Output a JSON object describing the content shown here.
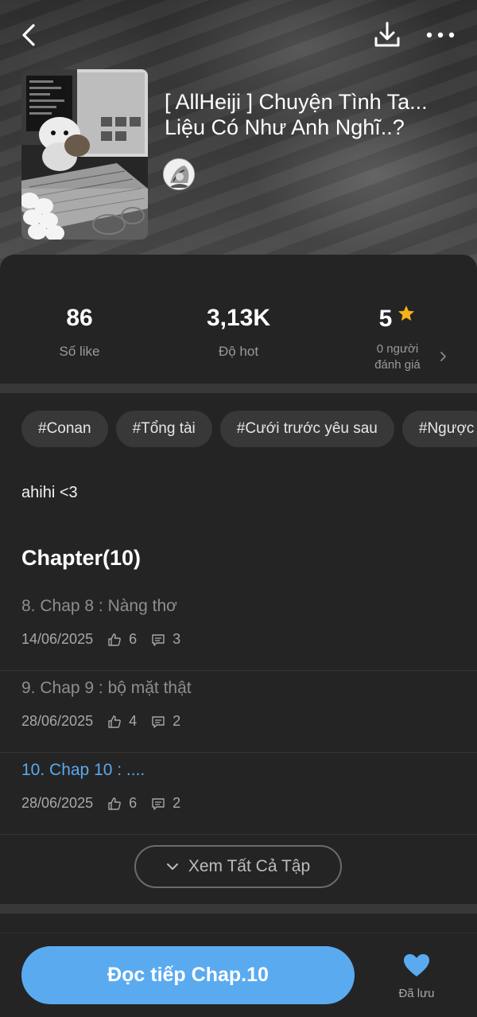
{
  "header": {
    "title": "[ AllHeiji ] Chuyện Tình Ta...\nLiệu Có Như Anh Nghĩ..?",
    "icons": {
      "back": "chevron-left-icon",
      "download": "download-icon",
      "more": "more-horizontal-icon"
    }
  },
  "stats": {
    "likes": {
      "value": "86",
      "label": "Số like"
    },
    "hot": {
      "value": "3,13K",
      "label": "Độ hot"
    },
    "rating": {
      "value": "5",
      "label_line1": "0 người",
      "label_line2": "đánh giá",
      "star_color": "#f5b21b"
    }
  },
  "tags": [
    "#Conan",
    "#Tổng tài",
    "#Cưới trước yêu sau",
    "#Ngược"
  ],
  "description": "ahihi <3",
  "chapters_header": "Chapter(10)",
  "chapters": [
    {
      "title": "8. Chap 8 : Nàng thơ",
      "date": "14/06/2025",
      "likes": "6",
      "comments": "3",
      "active": false
    },
    {
      "title": "9. Chap 9 : bộ mặt thật",
      "date": "28/06/2025",
      "likes": "4",
      "comments": "2",
      "active": false
    },
    {
      "title": "10. Chap 10 : ....",
      "date": "28/06/2025",
      "likes": "6",
      "comments": "2",
      "active": true
    }
  ],
  "view_all_label": "Xem Tất Cả Tập",
  "bottom": {
    "read_label": "Đọc tiếp Chap.10",
    "saved_label": "Đã lưu",
    "accent": "#5aaaf0",
    "heart_color": "#5aaaf0"
  }
}
